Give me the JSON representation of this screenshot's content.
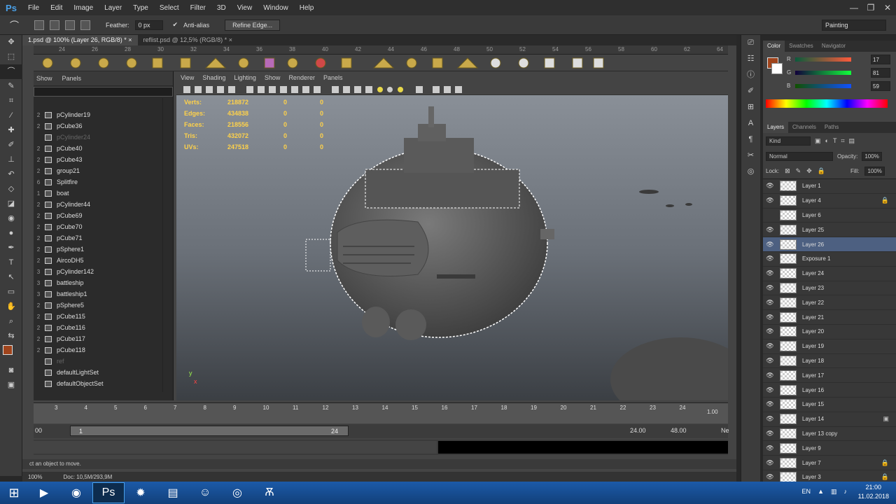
{
  "app": {
    "logo": "Ps"
  },
  "menu": [
    "File",
    "Edit",
    "Image",
    "Layer",
    "Type",
    "Select",
    "Filter",
    "3D",
    "View",
    "Window",
    "Help"
  ],
  "window_controls": [
    "—",
    "❐",
    "✕"
  ],
  "options": {
    "feather_label": "Feather:",
    "feather_value": "0 px",
    "antialias_label": "Anti-alias",
    "refine_edge": "Refine Edge...",
    "workspace": "Painting"
  },
  "doc_tabs": [
    {
      "label": "1.psd @ 100% (Layer 26, RGB/8) *",
      "close": "×"
    },
    {
      "label": "reflist.psd @ 12,5% (RGB/8) *",
      "close": "×"
    }
  ],
  "ruler_marks": [
    "24",
    "26",
    "28",
    "30",
    "32",
    "34",
    "36",
    "38",
    "40",
    "42",
    "44",
    "46",
    "48",
    "50",
    "52",
    "54",
    "56",
    "58",
    "60",
    "62",
    "64"
  ],
  "outliner": {
    "show": "Show",
    "panels": "Panels",
    "items": [
      {
        "num": "2",
        "name": "pCylinder19",
        "dim": false
      },
      {
        "num": "2",
        "name": "pCube36",
        "dim": false
      },
      {
        "num": "",
        "name": "pCylinder24",
        "dim": true
      },
      {
        "num": "2",
        "name": "pCube40",
        "dim": false
      },
      {
        "num": "2",
        "name": "pCube43",
        "dim": false
      },
      {
        "num": "2",
        "name": "group21",
        "dim": false
      },
      {
        "num": "6",
        "name": "Splitfire",
        "dim": false
      },
      {
        "num": "1",
        "name": "boat",
        "dim": false
      },
      {
        "num": "2",
        "name": "pCylinder44",
        "dim": false
      },
      {
        "num": "2",
        "name": "pCube69",
        "dim": false
      },
      {
        "num": "2",
        "name": "pCube70",
        "dim": false
      },
      {
        "num": "2",
        "name": "pCube71",
        "dim": false
      },
      {
        "num": "2",
        "name": "pSphere1",
        "dim": false
      },
      {
        "num": "2",
        "name": "AircoDH5",
        "dim": false
      },
      {
        "num": "3",
        "name": "pCylinder142",
        "dim": false
      },
      {
        "num": "3",
        "name": "battleship",
        "dim": false
      },
      {
        "num": "3",
        "name": "battleship1",
        "dim": false
      },
      {
        "num": "2",
        "name": "pSphere5",
        "dim": false
      },
      {
        "num": "2",
        "name": "pCube115",
        "dim": false
      },
      {
        "num": "2",
        "name": "pCube116",
        "dim": false
      },
      {
        "num": "2",
        "name": "pCube117",
        "dim": false
      },
      {
        "num": "2",
        "name": "pCube118",
        "dim": false
      },
      {
        "num": "",
        "name": "ref",
        "dim": true
      },
      {
        "num": "",
        "name": "defaultLightSet",
        "dim": false
      },
      {
        "num": "",
        "name": "defaultObjectSet",
        "dim": false
      }
    ]
  },
  "viewport": {
    "menu": [
      "View",
      "Shading",
      "Lighting",
      "Show",
      "Renderer",
      "Panels"
    ],
    "hud": [
      {
        "label": "Verts:",
        "v": "218872",
        "a": "0",
        "b": "0"
      },
      {
        "label": "Edges:",
        "v": "434838",
        "a": "0",
        "b": "0"
      },
      {
        "label": "Faces:",
        "v": "218556",
        "a": "0",
        "b": "0"
      },
      {
        "label": "Tris:",
        "v": "432072",
        "a": "0",
        "b": "0"
      },
      {
        "label": "UVs:",
        "v": "247518",
        "a": "0",
        "b": "0"
      }
    ],
    "axis_y": "y",
    "axis_x": "x"
  },
  "timeline": {
    "ticks": [
      "3",
      "4",
      "5",
      "6",
      "7",
      "8",
      "9",
      "10",
      "11",
      "12",
      "13",
      "14",
      "15",
      "16",
      "17",
      "18",
      "19",
      "20",
      "21",
      "22",
      "23",
      "24"
    ],
    "current": "1.00",
    "range_start": "00",
    "range_mid": "1",
    "range_end": "24",
    "end_a": "24.00",
    "end_b": "48.00",
    "end_c": "Ne"
  },
  "status_hint": "ct an object to move.",
  "ps_status": {
    "zoom": "100%",
    "doc": "Doc: 10,5M/293,9M"
  },
  "color_panel": {
    "tabs": [
      "Color",
      "Swatches",
      "Navigator"
    ],
    "r_label": "R",
    "g_label": "G",
    "b_label": "B",
    "r_value": "17",
    "g_value": "81",
    "b_value": "59",
    "fg": "#a0441c"
  },
  "layers_panel": {
    "tabs": [
      "Layers",
      "Channels",
      "Paths"
    ],
    "kind": "Kind",
    "blend": "Normal",
    "opacity_label": "Opacity:",
    "opacity": "100%",
    "lock_label": "Lock:",
    "fill_label": "Fill:",
    "fill": "100%",
    "layers": [
      {
        "name": "Layer 1",
        "eye": "👁",
        "lock": ""
      },
      {
        "name": "Layer 4",
        "eye": "👁",
        "lock": "🔒"
      },
      {
        "name": "Layer 6",
        "eye": "",
        "lock": ""
      },
      {
        "name": "Layer 25",
        "eye": "👁",
        "lock": ""
      },
      {
        "name": "Layer 26",
        "eye": "👁",
        "lock": "",
        "selected": true
      },
      {
        "name": "Exposure 1",
        "eye": "👁",
        "lock": ""
      },
      {
        "name": "Layer 24",
        "eye": "👁",
        "lock": ""
      },
      {
        "name": "Layer 23",
        "eye": "👁",
        "lock": ""
      },
      {
        "name": "Layer 22",
        "eye": "👁",
        "lock": ""
      },
      {
        "name": "Layer 21",
        "eye": "👁",
        "lock": ""
      },
      {
        "name": "Layer 20",
        "eye": "👁",
        "lock": ""
      },
      {
        "name": "Layer 19",
        "eye": "👁",
        "lock": ""
      },
      {
        "name": "Layer 18",
        "eye": "👁",
        "lock": ""
      },
      {
        "name": "Layer 17",
        "eye": "👁",
        "lock": ""
      },
      {
        "name": "Layer 16",
        "eye": "👁",
        "lock": ""
      },
      {
        "name": "Layer 15",
        "eye": "👁",
        "lock": ""
      },
      {
        "name": "Layer 14",
        "eye": "👁",
        "lock": "▣"
      },
      {
        "name": "Layer 13 copy",
        "eye": "👁",
        "lock": ""
      },
      {
        "name": "Layer 9",
        "eye": "👁",
        "lock": ""
      },
      {
        "name": "Layer 7",
        "eye": "👁",
        "lock": "🔒"
      },
      {
        "name": "Layer 3",
        "eye": "👁",
        "lock": "🔒"
      }
    ]
  },
  "taskbar": {
    "lang": "EN",
    "time": "21:00",
    "date": "11.02.2018"
  }
}
